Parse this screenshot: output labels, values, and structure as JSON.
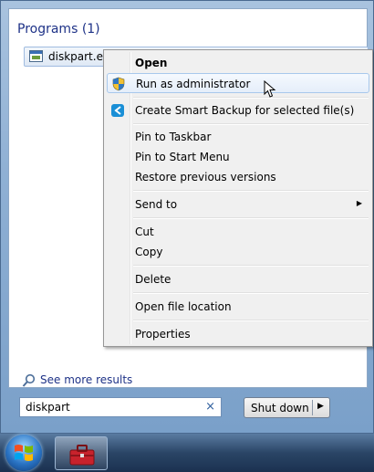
{
  "start_menu": {
    "section_title": "Programs (1)",
    "result_label": "diskpart.exe",
    "see_more_label": "See more results",
    "search_value": "diskpart",
    "clear_symbol": "×",
    "shutdown_label": "Shut down",
    "shutdown_arrow": "▶"
  },
  "context_menu": {
    "items": [
      {
        "label": "Open",
        "bold": true
      },
      {
        "label": "Run as administrator",
        "icon": "uac-shield-icon"
      },
      {
        "label": "Create Smart Backup for selected file(s)",
        "icon": "smart-backup-icon"
      },
      {
        "label": "Pin to Taskbar"
      },
      {
        "label": "Pin to Start Menu"
      },
      {
        "label": "Restore previous versions"
      },
      {
        "label": "Send to",
        "submenu_arrow": "▶"
      },
      {
        "label": "Cut"
      },
      {
        "label": "Copy"
      },
      {
        "label": "Delete"
      },
      {
        "label": "Open file location"
      },
      {
        "label": "Properties"
      }
    ]
  },
  "colors": {
    "section_title": "#1e3287",
    "highlight_border": "#a8c8ec",
    "menu_background": "#f0f0f0"
  }
}
